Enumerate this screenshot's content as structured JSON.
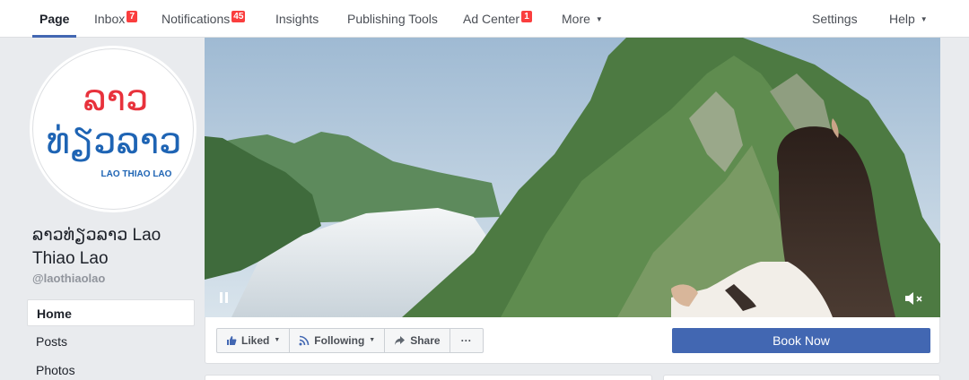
{
  "nav": {
    "items": [
      {
        "label": "Page",
        "badge": ""
      },
      {
        "label": "Inbox",
        "badge": "7"
      },
      {
        "label": "Notifications",
        "badge": "45"
      },
      {
        "label": "Insights",
        "badge": ""
      },
      {
        "label": "Publishing Tools",
        "badge": ""
      },
      {
        "label": "Ad Center",
        "badge": "1"
      },
      {
        "label": "More",
        "badge": ""
      }
    ],
    "right_items": [
      {
        "label": "Settings"
      },
      {
        "label": "Help"
      }
    ]
  },
  "profile": {
    "logo_script_line1": "ລາວ",
    "logo_script_line2": "ທ່ຽວລາວ",
    "logo_latin": "LAO THIAO LAO",
    "name": "ລາວທ່ຽວລາວ Lao Thiao Lao",
    "handle": "@laothiaolao"
  },
  "left_nav": {
    "items": [
      {
        "label": "Home"
      },
      {
        "label": "Posts"
      },
      {
        "label": "Photos"
      }
    ]
  },
  "cover": {
    "pause_icon": "pause-icon",
    "mute_icon": "volume-muted-icon"
  },
  "actions": {
    "liked_label": "Liked",
    "following_label": "Following",
    "share_label": "Share",
    "more_label": "···",
    "book_now_label": "Book Now"
  },
  "colors": {
    "brand_blue": "#4267b2",
    "badge_red": "#fa3e3e",
    "logo_red": "#e8323c",
    "logo_blue": "#1e64b4"
  }
}
